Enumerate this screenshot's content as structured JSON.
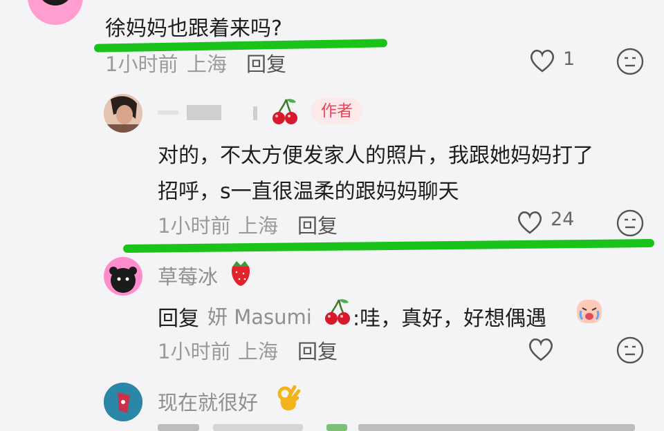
{
  "comments": [
    {
      "text": "徐妈妈也跟着来吗?",
      "time": "1小时前",
      "location": "上海",
      "reply_label": "回复",
      "like_count": "1"
    }
  ],
  "author_reply": {
    "badge": "作者",
    "line1": "对的，不太方便发家人的照片，我跟她妈妈打了",
    "line2": "招呼，s一直很温柔的跟妈妈聊天",
    "time": "1小时前",
    "location": "上海",
    "reply_label": "回复",
    "like_count": "24"
  },
  "reply_strawberry": {
    "username": "草莓冰",
    "prefix": "回复",
    "target": "妍 Masumi",
    "body": ":哇，真好，好想偶遇",
    "time": "1小时前",
    "location": "上海",
    "reply_label": "回复"
  },
  "reply_last": {
    "username": "现在就很好"
  },
  "colors": {
    "highlight_green": "#19c319",
    "badge_bg": "#fde8ea",
    "badge_text": "#e9455c"
  }
}
